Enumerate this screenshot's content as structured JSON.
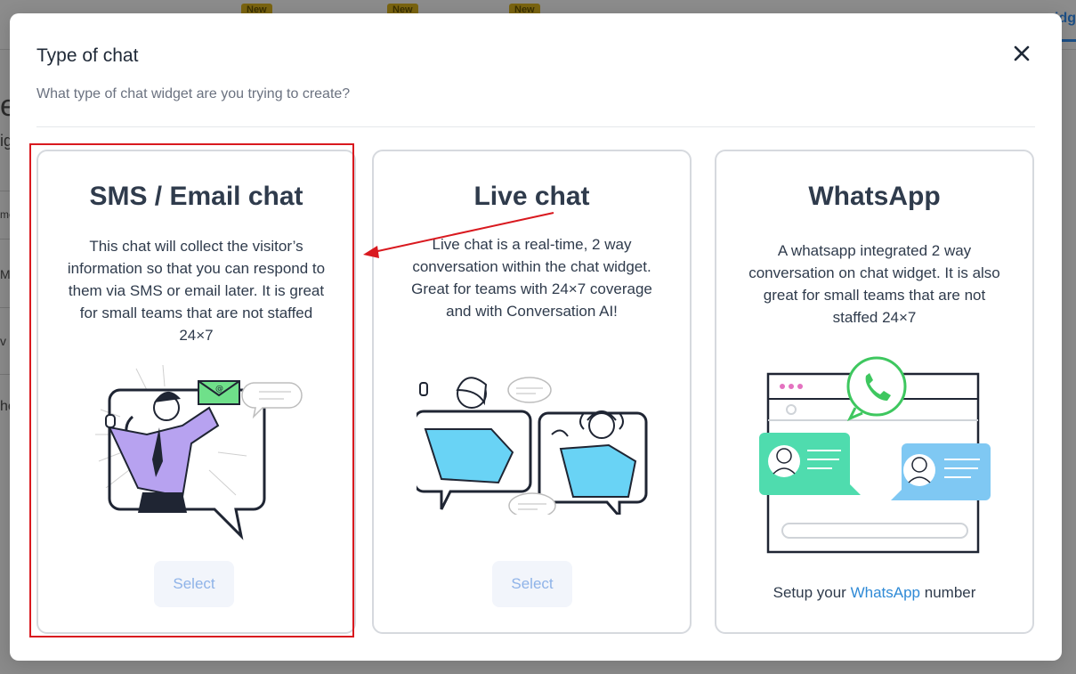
{
  "background": {
    "new_badges": [
      "New",
      "New",
      "New"
    ],
    "fragments": [
      "e",
      "ig",
      "me",
      "M",
      "v",
      "he"
    ],
    "right_tab": "idg"
  },
  "modal": {
    "title": "Type of chat",
    "subtitle": "What type of chat widget are you trying to create?",
    "close_icon": "close-icon"
  },
  "cards": [
    {
      "title": "SMS / Email chat",
      "description": "This chat will collect the visitor’s information so that you can respond to them via SMS or email later. It is great for small teams that are not staffed 24×7",
      "illustration": "person-with-envelope-illustration",
      "button": "Select"
    },
    {
      "title": "Live chat",
      "description": "Live chat is a real-time, 2 way conversation within the chat widget. Great for teams with 24×7 coverage and with Conversation AI!",
      "illustration": "two-people-chatting-illustration",
      "button": "Select"
    },
    {
      "title": "WhatsApp",
      "description": "A whatsapp integrated 2 way conversation on chat widget. It is also great for small teams that are not staffed 24×7",
      "illustration": "whatsapp-chat-window-illustration",
      "footnote_before": "Setup your",
      "footnote_link": "WhatsApp",
      "footnote_after": "number"
    }
  ],
  "colors": {
    "accent": "#2f8ad6",
    "annotation": "#d9191f",
    "whatsapp": "#3ec75f"
  }
}
